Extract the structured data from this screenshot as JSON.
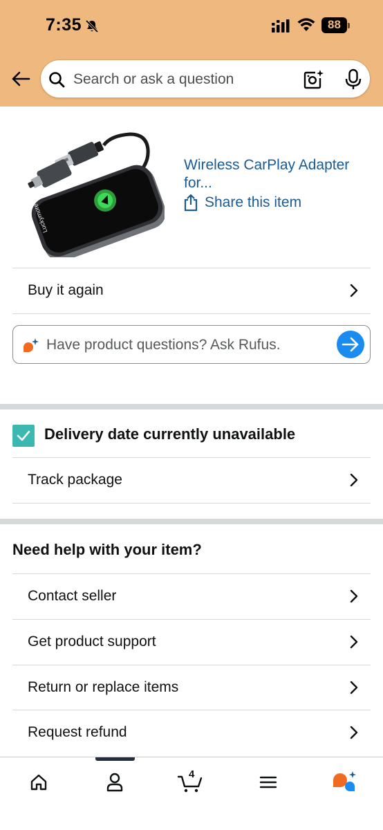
{
  "status_bar": {
    "time": "7:35",
    "battery": "88"
  },
  "search": {
    "placeholder": "Search or ask a question"
  },
  "product": {
    "title": "Wireless CarPlay Adapter for...",
    "share_label": "Share this item",
    "brand_on_image": "Luckymore"
  },
  "buy_again": {
    "label": "Buy it again"
  },
  "rufus": {
    "placeholder": "Have product questions? Ask Rufus."
  },
  "delivery": {
    "status": "Delivery date currently unavailable",
    "track_label": "Track package"
  },
  "help": {
    "heading": "Need help with your item?",
    "items": [
      {
        "label": "Contact seller"
      },
      {
        "label": "Get product support"
      },
      {
        "label": "Return or replace items"
      },
      {
        "label": "Request refund"
      }
    ]
  },
  "bottom_nav": {
    "cart_count": "4",
    "items": [
      {
        "icon": "home-icon"
      },
      {
        "icon": "account-icon"
      },
      {
        "icon": "cart-icon"
      },
      {
        "icon": "menu-icon"
      },
      {
        "icon": "rufus-icon"
      }
    ]
  },
  "colors": {
    "header_bg": "#efb87e",
    "link": "#1a5b93",
    "accent_blue": "#1a8cf0",
    "check_teal": "#3bb8b0",
    "rufus_orange": "#f06b1f"
  }
}
